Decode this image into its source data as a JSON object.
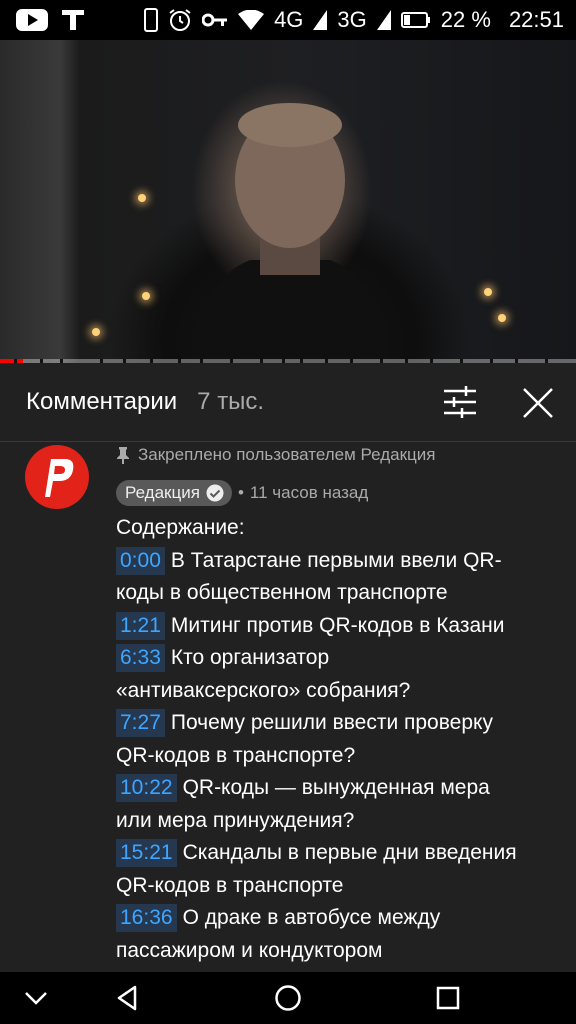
{
  "status_bar": {
    "network_4g": "4G",
    "network_3g": "3G",
    "battery": "22 %",
    "time": "22:51",
    "icons_left": [
      "youtube-icon",
      "t-app-icon"
    ],
    "icons_right": [
      "phone-icon",
      "alarm-icon",
      "key-icon",
      "wifi-icon",
      "signal-icon",
      "battery-icon"
    ]
  },
  "video": {
    "progress_fraction": 0.04
  },
  "comments_header": {
    "title": "Комментарии",
    "count": "7 тыс.",
    "filter_icon": "sort-filter-icon",
    "close_icon": "close-icon"
  },
  "comment": {
    "pinned_text": "Закреплено пользователем Редакция",
    "author": "Редакция",
    "time_prefix": "•",
    "time": "11 часов назад",
    "intro": "Содержание:",
    "entries": [
      {
        "ts": "0:00",
        "line1": "В Татарстане первыми ввели QR-",
        "line2": "коды в общественном транспорте"
      },
      {
        "ts": "1:21",
        "line1": "Митинг против QR-кодов в Казани",
        "line2": ""
      },
      {
        "ts": "6:33",
        "line1": "Кто организатор",
        "line2": "«антиваксерского» собрания?"
      },
      {
        "ts": "7:27",
        "line1": "Почему решили ввести проверку",
        "line2": "QR-кодов в транспорте?"
      },
      {
        "ts": "10:22",
        "line1": "QR-коды — вынужденная мера",
        "line2": "или мера принуждения?"
      },
      {
        "ts": "15:21",
        "line1": "Скандалы в первые дни введения",
        "line2": "QR-кодов в транспорте"
      },
      {
        "ts": "16:36",
        "line1": "О драке в автобусе между",
        "line2": "пассажиром и кондуктором"
      }
    ]
  },
  "colors": {
    "accent_red": "#ff0000",
    "timestamp_blue": "#3ea6ff",
    "avatar_red": "#e2231a"
  }
}
